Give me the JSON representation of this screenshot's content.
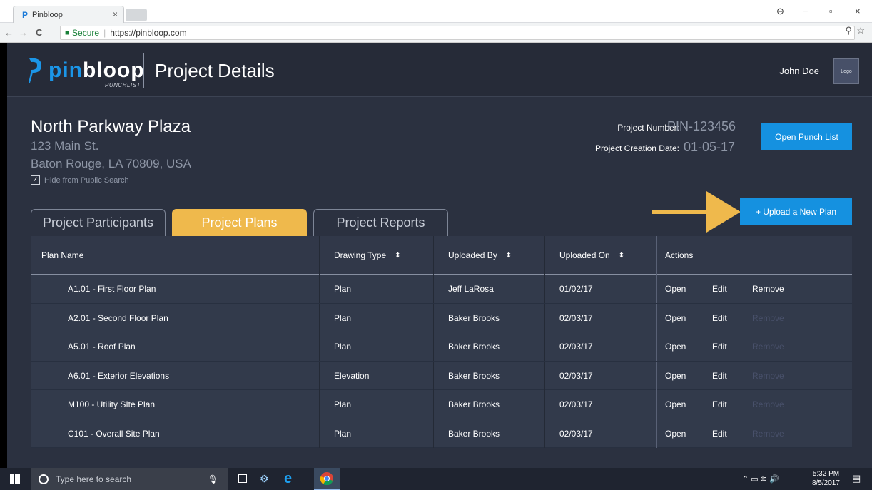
{
  "browser": {
    "tab_title": "Pinbloop",
    "tab_close": "×",
    "favicon": "P",
    "secure_label": "Secure",
    "url": "https://pinbloop.com",
    "back": "←",
    "forward": "→",
    "reload": "C",
    "zoom_icon": "⚲",
    "star_icon": "☆",
    "menu_icon": "⋮",
    "win_user": "⊖",
    "win_min": "−",
    "win_max": "▫",
    "win_close": "×"
  },
  "header": {
    "brand_pin": "pin",
    "brand_rest": "bloop",
    "brand_sub": "PUNCHLIST",
    "page_title": "Project Details",
    "user_name": "John Doe",
    "logo_placeholder": "Logo"
  },
  "project": {
    "name": "North Parkway Plaza",
    "address_line1": "123 Main St.",
    "address_line2": "Baton Rouge, LA 70809, USA",
    "hide_label": "Hide from Public Search",
    "hide_checked": true,
    "number_label": "Project Number:",
    "number_value": "PIN-123456",
    "date_label": "Project Creation Date:",
    "date_value": "01-05-17",
    "open_punch_label": "Open Punch List",
    "upload_label": "+ Upload a New Plan"
  },
  "tabs": [
    {
      "label": "Project Participants",
      "active": false
    },
    {
      "label": "Project Plans",
      "active": true
    },
    {
      "label": "Project Reports",
      "active": false
    }
  ],
  "table": {
    "columns": {
      "plan_name": "Plan Name",
      "drawing_type": "Drawing Type",
      "uploaded_by": "Uploaded By",
      "uploaded_on": "Uploaded On",
      "actions": "Actions",
      "sort_icon": "⬍"
    },
    "rows": [
      {
        "plan": "A1.01 - First Floor Plan",
        "type": "Plan",
        "by": "Jeff LaRosa",
        "on": "01/02/17",
        "open": "Open",
        "edit": "Edit",
        "remove": "Remove",
        "remove_enabled": true
      },
      {
        "plan": "A2.01 - Second Floor Plan",
        "type": "Plan",
        "by": "Baker Brooks",
        "on": "02/03/17",
        "open": "Open",
        "edit": "Edit",
        "remove": "Remove",
        "remove_enabled": false
      },
      {
        "plan": "A5.01 - Roof Plan",
        "type": "Plan",
        "by": "Baker Brooks",
        "on": "02/03/17",
        "open": "Open",
        "edit": "Edit",
        "remove": "Remove",
        "remove_enabled": false
      },
      {
        "plan": "A6.01 - Exterior Elevations",
        "type": "Elevation",
        "by": "Baker Brooks",
        "on": "02/03/17",
        "open": "Open",
        "edit": "Edit",
        "remove": "Remove",
        "remove_enabled": false
      },
      {
        "plan": "M100 - Utility SIte Plan",
        "type": "Plan",
        "by": "Baker Brooks",
        "on": "02/03/17",
        "open": "Open",
        "edit": "Edit",
        "remove": "Remove",
        "remove_enabled": false
      },
      {
        "plan": "C101 - Overall Site Plan",
        "type": "Plan",
        "by": "Baker Brooks",
        "on": "02/03/17",
        "open": "Open",
        "edit": "Edit",
        "remove": "Remove",
        "remove_enabled": false
      }
    ]
  },
  "taskbar": {
    "search_placeholder": "Type here to search",
    "time": "5:32 PM",
    "date": "8/5/2017"
  },
  "colors": {
    "accent_blue": "#1591e0",
    "tab_active": "#efb94c",
    "app_bg": "#2b3140",
    "arrow": "#efb94c"
  }
}
